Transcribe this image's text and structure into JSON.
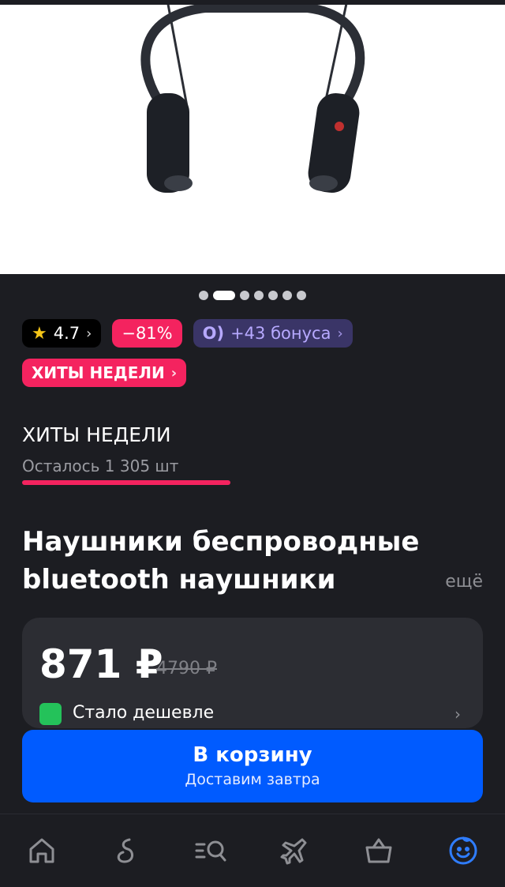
{
  "gallery": {
    "dots_total": 7,
    "active_index": 1
  },
  "badges": {
    "rating": "4.7",
    "discount": "−81%",
    "bonus": "+43 бонуса",
    "bonus_icon_text": "O)"
  },
  "promo": {
    "hits_badge": "ХИТЫ НЕДЕЛИ",
    "hits_title": "ХИТЫ НЕДЕЛИ",
    "stock_left": "Осталось 1 305 шт"
  },
  "product": {
    "title": "Наушники беспроводные bluetooth наушники",
    "more_link": "ещё"
  },
  "price": {
    "current": "871 ₽",
    "old": "4790 ₽",
    "cheaper_label": "Стало дешевле"
  },
  "cart_button": {
    "label": "В корзину",
    "sublabel": "Доставим завтра"
  },
  "nav": {
    "items": [
      {
        "icon": "home-icon"
      },
      {
        "icon": "ozon-fresh-icon"
      },
      {
        "icon": "catalog-search-icon"
      },
      {
        "icon": "travel-plane-icon"
      },
      {
        "icon": "cart-basket-icon"
      },
      {
        "icon": "profile-smile-icon"
      }
    ],
    "active_color": "#2f7dff",
    "inactive_color": "#8e8f94"
  },
  "colors": {
    "accent_pink": "#f4235f",
    "primary_blue": "#005bff",
    "bonus_purple": "#b7a9ff",
    "background": "#1c1d22"
  }
}
